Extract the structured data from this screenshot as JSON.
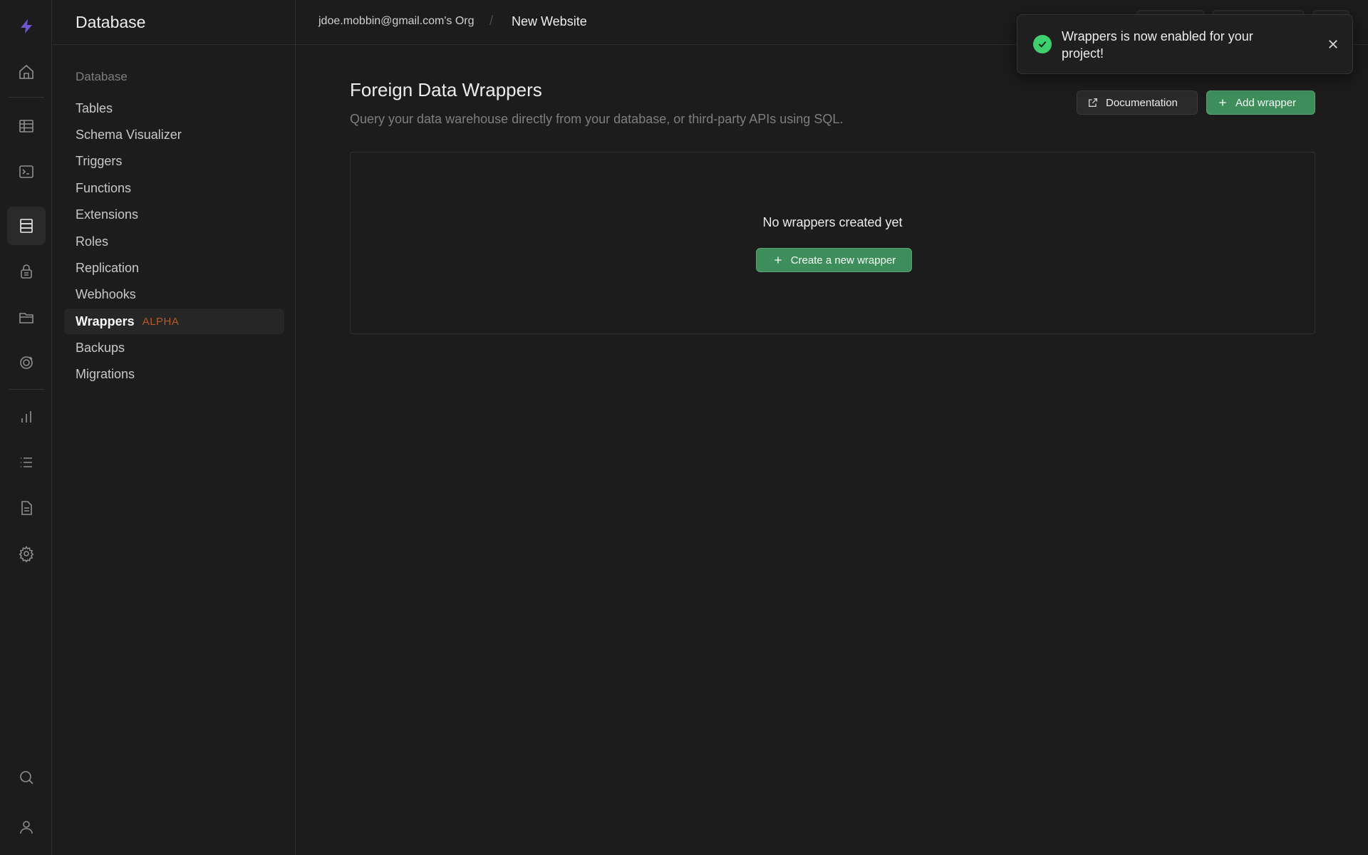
{
  "sidebar": {
    "title": "Database",
    "group_label": "Database",
    "items": [
      {
        "label": "Tables"
      },
      {
        "label": "Schema Visualizer"
      },
      {
        "label": "Triggers"
      },
      {
        "label": "Functions"
      },
      {
        "label": "Extensions"
      },
      {
        "label": "Roles"
      },
      {
        "label": "Replication"
      },
      {
        "label": "Webhooks"
      },
      {
        "label": "Wrappers",
        "badge": "ALPHA",
        "active": true
      },
      {
        "label": "Backups"
      },
      {
        "label": "Migrations"
      }
    ]
  },
  "rail": {
    "icons": [
      "bolt-logo-icon",
      "home-icon",
      "table-editor-icon",
      "sql-editor-icon",
      "database-icon",
      "auth-lock-icon",
      "storage-icon",
      "realtime-icon",
      "reports-icon",
      "logs-icon",
      "docs-icon",
      "settings-icon",
      "search-icon",
      "user-icon"
    ],
    "accent": "#6e56cf"
  },
  "header": {
    "org": "jdoe.mobbin@gmail.com's Org",
    "separator": "/",
    "project": "New Website"
  },
  "page": {
    "title": "Foreign Data Wrappers",
    "subtitle": "Query your data warehouse directly from your database, or third-party APIs using SQL.",
    "documentation_label": "Documentation",
    "add_wrapper_label": "Add wrapper",
    "empty_title": "No wrappers created yet",
    "create_label": "Create a new wrapper"
  },
  "toast": {
    "message": "Wrappers is now enabled for your project!",
    "status_color": "#3ecf6e"
  },
  "colors": {
    "background": "#1c1c1c",
    "brand_green": "#3e8e5c",
    "badge_orange": "#b8592a"
  }
}
